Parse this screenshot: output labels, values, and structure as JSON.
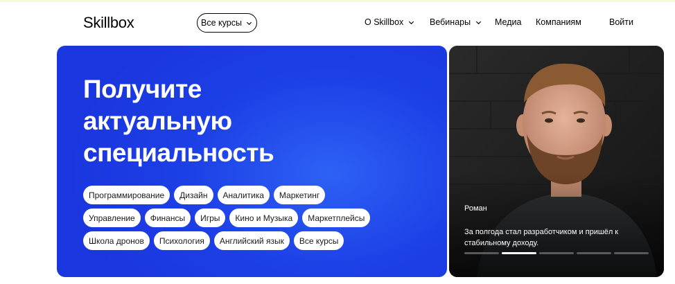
{
  "header": {
    "logo": "Skillbox",
    "all_courses_label": "Все курсы",
    "nav": [
      {
        "label": "О Skillbox",
        "has_dropdown": true
      },
      {
        "label": "Вебинары",
        "has_dropdown": true
      },
      {
        "label": "Медиа",
        "has_dropdown": false
      },
      {
        "label": "Компаниям",
        "has_dropdown": false
      }
    ],
    "login_label": "Войти"
  },
  "hero": {
    "title_lines": [
      "Получите",
      "актуальную",
      "специальность"
    ],
    "chip_rows": [
      [
        "Программирование",
        "Дизайн",
        "Аналитика",
        "Маркетинг"
      ],
      [
        "Управление",
        "Финансы",
        "Игры",
        "Кино и Музыка",
        "Маркетплейсы"
      ],
      [
        "Школа дронов",
        "Психология",
        "Английский язык",
        "Все курсы"
      ]
    ],
    "colors": {
      "background": "#1d3fe6",
      "chip": "#ffffff"
    }
  },
  "story": {
    "name": "Роман",
    "quote": "За полгода стал разработчиком и пришёл к стабильному доходу.",
    "progress_segments": 5,
    "active_segment": 2,
    "icon": "person-photo"
  }
}
